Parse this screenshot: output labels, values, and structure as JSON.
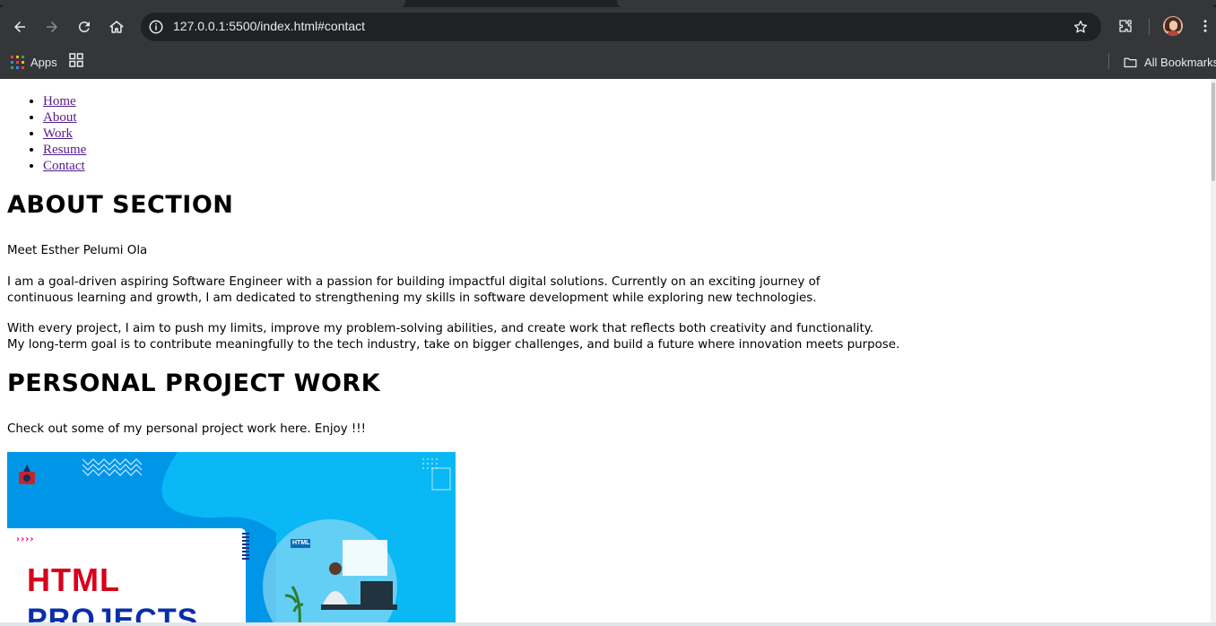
{
  "browser": {
    "url": "127.0.0.1:5500/index.html#contact",
    "bookmarks": {
      "apps_label": "Apps",
      "all_bookmarks_label": "All Bookmarks"
    },
    "icons": {
      "back": "back-arrow-icon",
      "forward": "forward-arrow-icon",
      "reload": "reload-icon",
      "home": "home-icon",
      "site_info": "site-info-icon",
      "bookmark_star": "star-icon",
      "extensions": "puzzle-icon",
      "menu": "kebab-menu-icon"
    },
    "colors": {
      "chrome_bg": "#35363a",
      "omnibox_bg": "#202124",
      "text": "#e8eaed"
    }
  },
  "page": {
    "nav": [
      {
        "label": "Home"
      },
      {
        "label": "About"
      },
      {
        "label": "Work"
      },
      {
        "label": "Resume"
      },
      {
        "label": "Contact"
      }
    ],
    "about": {
      "heading": "ABOUT SECTION",
      "intro": "Meet Esther Pelumi Ola",
      "para1_line1": "I am a goal-driven aspiring Software Engineer with a passion for building impactful digital solutions. Currently on an exciting journey of",
      "para1_line2": "continuous learning and growth, I am dedicated to strengthening my skills in software development while exploring new technologies.",
      "para2_line1": "With every project, I aim to push my limits, improve my problem-solving abilities, and create work that reflects both creativity and functionality.",
      "para2_line2": "My long-term goal is to contribute meaningfully to the tech industry, take on bigger challenges, and build a future where innovation meets purpose."
    },
    "projects": {
      "heading": "PERSONAL PROJECT WORK",
      "intro": "Check out some of my personal project work here. Enjoy !!!",
      "thumbnail": {
        "title": "HTML",
        "subtitle": "PROJECTS",
        "arrows": "››››",
        "tag": "HTML"
      }
    },
    "colors": {
      "link_visited": "#551a8b",
      "thumbnail_bg": "#0ab8f5",
      "thumbnail_title": "#d8001a",
      "thumbnail_subtitle": "#0a2ea8"
    }
  }
}
